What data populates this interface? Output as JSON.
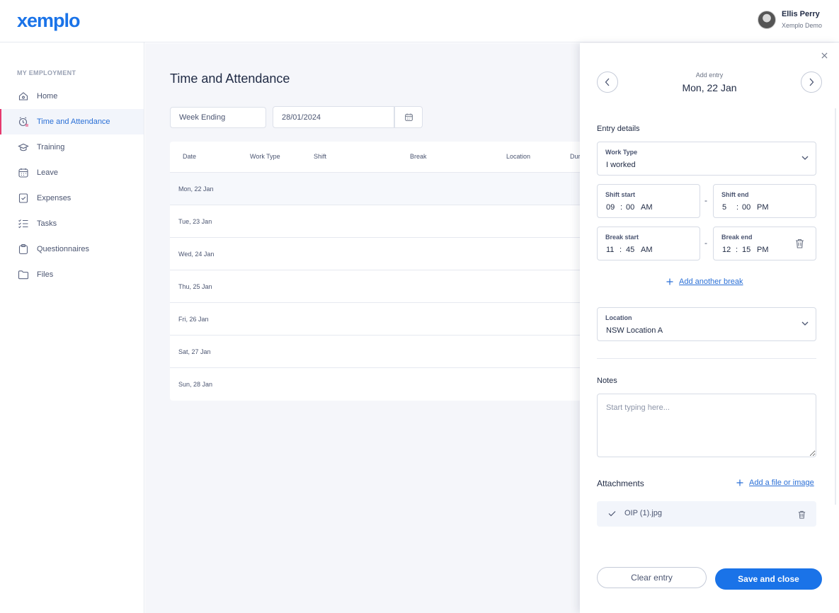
{
  "brand": {
    "logo": "xemplo",
    "accent": "#1a73e8"
  },
  "user": {
    "name": "Ellis Perry",
    "org": "Xemplo Demo"
  },
  "sidebar": {
    "heading": "MY EMPLOYMENT",
    "items": [
      {
        "label": "Home",
        "icon": "home-icon"
      },
      {
        "label": "Time and Attendance",
        "icon": "clock-icon",
        "active": true
      },
      {
        "label": "Training",
        "icon": "graduation-cap-icon"
      },
      {
        "label": "Leave",
        "icon": "calendar-icon"
      },
      {
        "label": "Expenses",
        "icon": "receipt-icon"
      },
      {
        "label": "Tasks",
        "icon": "checklist-icon"
      },
      {
        "label": "Questionnaires",
        "icon": "clipboard-icon"
      },
      {
        "label": "Files",
        "icon": "folder-icon"
      }
    ]
  },
  "main": {
    "title": "Time and Attendance",
    "filter": {
      "label": "Week Ending"
    },
    "date": {
      "value": "28/01/2024"
    },
    "table": {
      "columns": [
        "Date",
        "Work Type",
        "Shift",
        "Break",
        "Location",
        "Dur"
      ],
      "rows": [
        {
          "date": "Mon, 22 Jan"
        },
        {
          "date": "Tue, 23 Jan"
        },
        {
          "date": "Wed, 24 Jan"
        },
        {
          "date": "Thu, 25 Jan"
        },
        {
          "date": "Fri, 26 Jan"
        },
        {
          "date": "Sat, 27 Jan"
        },
        {
          "date": "Sun, 28 Jan"
        }
      ]
    }
  },
  "panel": {
    "subtitle": "Add entry",
    "date": "Mon, 22 Jan",
    "entry_details_label": "Entry details",
    "work_type": {
      "label": "Work Type",
      "value": "I worked"
    },
    "shift_start": {
      "label": "Shift start",
      "hour": "09",
      "minute": "00",
      "period": "AM"
    },
    "shift_end": {
      "label": "Shift end",
      "hour": "5",
      "minute": "00",
      "period": "PM"
    },
    "break_start": {
      "label": "Break start",
      "hour": "11",
      "minute": "45",
      "period": "AM"
    },
    "break_end": {
      "label": "Break end",
      "hour": "12",
      "minute": "15",
      "period": "PM"
    },
    "time_separator": ":",
    "range_dash": "-",
    "add_break": "Add another break",
    "location": {
      "label": "Location",
      "value": "NSW Location A"
    },
    "notes": {
      "label": "Notes",
      "placeholder": "Start typing here..."
    },
    "attachments": {
      "label": "Attachments",
      "add_link": "Add a file or image",
      "files": [
        {
          "name": "OIP (1).jpg"
        }
      ]
    },
    "buttons": {
      "clear": "Clear entry",
      "save": "Save and close"
    }
  }
}
